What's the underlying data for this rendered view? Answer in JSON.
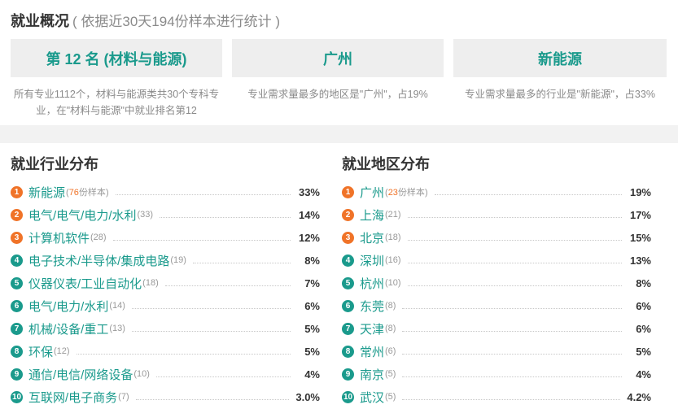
{
  "overview": {
    "title": "就业概况",
    "subtitle": "( 依据近30天194份样本进行统计 )",
    "cards": [
      {
        "value": "第 12 名 (材料与能源)",
        "desc": "所有专业1112个，材料与能源类共30个专科专业，在\"材料与能源\"中就业排名第12"
      },
      {
        "value": "广州",
        "desc": "专业需求量最多的地区是\"广州\"，占19%"
      },
      {
        "value": "新能源",
        "desc": "专业需求量最多的行业是\"新能源\"，占33%"
      }
    ]
  },
  "industry": {
    "title": "就业行业分布",
    "sample_suffix": "份样本",
    "items": [
      {
        "rank": "1",
        "name": "新能源",
        "count": "76",
        "pct": "33%"
      },
      {
        "rank": "2",
        "name": "电气/电气/电力/水利",
        "count": "(33)",
        "pct": "14%"
      },
      {
        "rank": "3",
        "name": "计算机软件",
        "count": "(28)",
        "pct": "12%"
      },
      {
        "rank": "4",
        "name": "电子技术/半导体/集成电路",
        "count": "(19)",
        "pct": "8%"
      },
      {
        "rank": "5",
        "name": "仪器仪表/工业自动化",
        "count": "(18)",
        "pct": "7%"
      },
      {
        "rank": "6",
        "name": "电气/电力/水利",
        "count": "(14)",
        "pct": "6%"
      },
      {
        "rank": "7",
        "name": "机械/设备/重工",
        "count": "(13)",
        "pct": "5%"
      },
      {
        "rank": "8",
        "name": "环保",
        "count": "(12)",
        "pct": "5%"
      },
      {
        "rank": "9",
        "name": "通信/电信/网络设备",
        "count": "(10)",
        "pct": "4%"
      },
      {
        "rank": "10",
        "name": "互联网/电子商务",
        "count": "(7)",
        "pct": "3.0%"
      }
    ]
  },
  "region": {
    "title": "就业地区分布",
    "sample_suffix": "份样本",
    "items": [
      {
        "rank": "1",
        "name": "广州",
        "count": "23",
        "pct": "19%"
      },
      {
        "rank": "2",
        "name": "上海",
        "count": "(21)",
        "pct": "17%"
      },
      {
        "rank": "3",
        "name": "北京",
        "count": "(18)",
        "pct": "15%"
      },
      {
        "rank": "4",
        "name": "深圳",
        "count": "(16)",
        "pct": "13%"
      },
      {
        "rank": "5",
        "name": "杭州",
        "count": "(10)",
        "pct": "8%"
      },
      {
        "rank": "6",
        "name": "东莞",
        "count": "(8)",
        "pct": "6%"
      },
      {
        "rank": "7",
        "name": "天津",
        "count": "(8)",
        "pct": "6%"
      },
      {
        "rank": "8",
        "name": "常州",
        "count": "(6)",
        "pct": "5%"
      },
      {
        "rank": "9",
        "name": "南京",
        "count": "(5)",
        "pct": "4%"
      },
      {
        "rank": "10",
        "name": "武汉",
        "count": "(5)",
        "pct": "4.2%"
      }
    ]
  },
  "colors": {
    "accent": "#1a9a8c",
    "rank_top": "#f07328",
    "card_bg": "#eeeeee"
  }
}
